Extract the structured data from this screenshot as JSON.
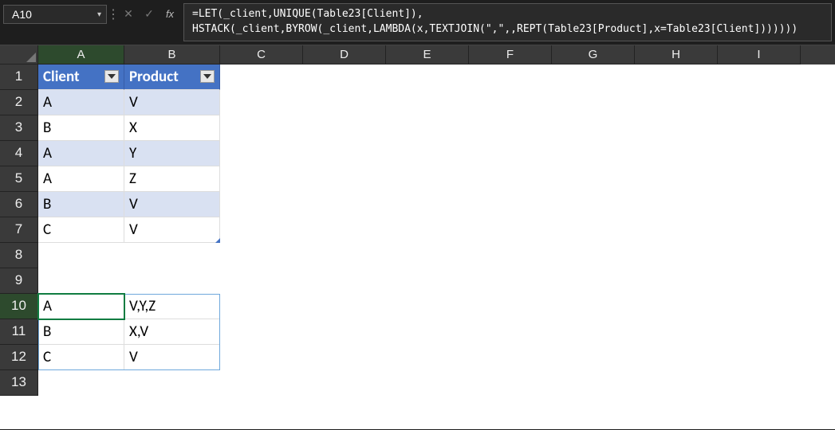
{
  "nameBox": {
    "value": "A10"
  },
  "formulaBar": {
    "cancelIcon": "✕",
    "acceptIcon": "✓",
    "fxLabel": "fx",
    "formula": "=LET(_client,UNIQUE(Table23[Client]),\nHSTACK(_client,BYROW(_client,LAMBDA(x,TEXTJOIN(\",\",,REPT(Table23[Product],x=Table23[Client]))))))"
  },
  "columns": [
    "A",
    "B",
    "C",
    "D",
    "E",
    "F",
    "G",
    "H",
    "I"
  ],
  "rows": [
    "1",
    "2",
    "3",
    "4",
    "5",
    "6",
    "7",
    "8",
    "9",
    "10",
    "11",
    "12",
    "13"
  ],
  "table": {
    "headers": {
      "A": "Client",
      "B": "Product"
    },
    "data": [
      {
        "client": "A",
        "product": "V"
      },
      {
        "client": "B",
        "product": "X"
      },
      {
        "client": "A",
        "product": "Y"
      },
      {
        "client": "A",
        "product": "Z"
      },
      {
        "client": "B",
        "product": "V"
      },
      {
        "client": "C",
        "product": "V"
      }
    ]
  },
  "spill": {
    "data": [
      {
        "A": "A",
        "B": "V,Y,Z"
      },
      {
        "A": "B",
        "B": "X,V"
      },
      {
        "A": "C",
        "B": "V"
      }
    ]
  },
  "activeCell": "A10"
}
